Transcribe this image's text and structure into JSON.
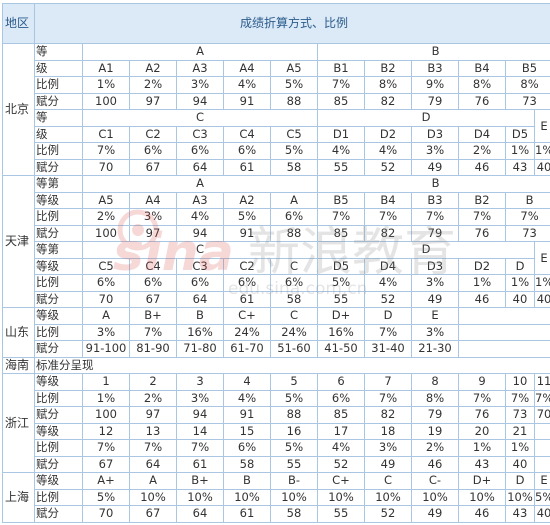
{
  "header": {
    "region": "地区",
    "title": "成绩折算方式、比例"
  },
  "watermark": {
    "brand_latin": "sina",
    "brand_cn": "新浪教育",
    "url": "edu.sina.com.cn"
  },
  "regions": {
    "beijing": {
      "name": "北京",
      "block1": {
        "label_top": "等",
        "label_grade": "级",
        "label_ratio": "比例",
        "label_score": "赋分",
        "groups": [
          "A",
          "B"
        ],
        "grades": [
          "A1",
          "A2",
          "A3",
          "A4",
          "A5",
          "B1",
          "B2",
          "B3",
          "B4",
          "B5"
        ],
        "ratios": [
          "1%",
          "2%",
          "3%",
          "4%",
          "5%",
          "7%",
          "8%",
          "9%",
          "8%",
          "8%"
        ],
        "scores": [
          "100",
          "97",
          "94",
          "91",
          "88",
          "85",
          "82",
          "79",
          "76",
          "73"
        ]
      },
      "block2": {
        "label_top": "等",
        "label_grade": "级",
        "label_ratio": "比例",
        "label_score": "赋分",
        "groups": [
          "C",
          "D",
          "E"
        ],
        "grades": [
          "C1",
          "C2",
          "C3",
          "C4",
          "C5",
          "D1",
          "D2",
          "D3",
          "D4",
          "D5"
        ],
        "ratios": [
          "7%",
          "6%",
          "6%",
          "6%",
          "5%",
          "4%",
          "4%",
          "3%",
          "2%",
          "1%",
          "1%"
        ],
        "scores": [
          "70",
          "67",
          "64",
          "61",
          "58",
          "55",
          "52",
          "49",
          "46",
          "43",
          "40"
        ]
      }
    },
    "tianjin": {
      "name": "天津",
      "block1": {
        "label_top": "等第",
        "label_grade": "等级",
        "label_ratio": "比例",
        "label_score": "赋分",
        "groups": [
          "A",
          "B"
        ],
        "grades": [
          "A5",
          "A4",
          "A3",
          "A2",
          "A",
          "B5",
          "B4",
          "B3",
          "B2",
          "B"
        ],
        "ratios": [
          "2%",
          "3%",
          "4%",
          "5%",
          "6%",
          "7%",
          "7%",
          "7%",
          "7%",
          "7%"
        ],
        "scores": [
          "100",
          "97",
          "94",
          "91",
          "88",
          "85",
          "82",
          "79",
          "76",
          "73"
        ]
      },
      "block2": {
        "label_top": "等第",
        "label_grade": "等级",
        "label_ratio": "比例",
        "label_score": "赋分",
        "groups": [
          "C",
          "D",
          "E"
        ],
        "grades": [
          "C5",
          "C4",
          "C3",
          "C2",
          "C",
          "D5",
          "D4",
          "D3",
          "D2",
          "D"
        ],
        "ratios": [
          "6%",
          "6%",
          "6%",
          "6%",
          "6%",
          "5%",
          "4%",
          "3%",
          "1%",
          "1%",
          "1%"
        ],
        "scores": [
          "70",
          "67",
          "64",
          "61",
          "58",
          "55",
          "52",
          "49",
          "46",
          "40",
          "40"
        ]
      }
    },
    "shandong": {
      "name": "山东",
      "label_grade": "等级",
      "label_ratio": "比例",
      "label_score": "赋分",
      "grades": [
        "A",
        "B+",
        "B",
        "C+",
        "C",
        "D+",
        "D",
        "E"
      ],
      "ratios": [
        "3%",
        "7%",
        "16%",
        "24%",
        "24%",
        "16%",
        "7%",
        "3%"
      ],
      "scores": [
        "91-100",
        "81-90",
        "71-80",
        "61-70",
        "51-60",
        "41-50",
        "31-40",
        "21-30"
      ]
    },
    "hainan": {
      "name": "海南",
      "note": "标准分呈现"
    },
    "zhejiang": {
      "name": "浙江",
      "block1": {
        "label_grade": "等级",
        "label_ratio": "比例",
        "label_score": "赋分",
        "grades": [
          "1",
          "2",
          "3",
          "4",
          "5",
          "6",
          "7",
          "8",
          "9",
          "10",
          "11"
        ],
        "ratios": [
          "1%",
          "2%",
          "3%",
          "4%",
          "5%",
          "6%",
          "7%",
          "8%",
          "7%",
          "7%",
          "7%"
        ],
        "scores": [
          "100",
          "97",
          "94",
          "91",
          "88",
          "85",
          "82",
          "79",
          "76",
          "73",
          "70"
        ]
      },
      "block2": {
        "label_grade": "等级",
        "label_ratio": "比例",
        "label_score": "赋分",
        "grades": [
          "12",
          "13",
          "14",
          "15",
          "16",
          "17",
          "18",
          "19",
          "20",
          "21"
        ],
        "ratios": [
          "7%",
          "7%",
          "7%",
          "6%",
          "5%",
          "4%",
          "3%",
          "2%",
          "1%",
          "1%"
        ],
        "scores": [
          "67",
          "64",
          "61",
          "58",
          "55",
          "52",
          "49",
          "46",
          "43",
          "40"
        ]
      }
    },
    "shanghai": {
      "name": "上海",
      "label_grade": "等级",
      "label_ratio": "比例",
      "label_score": "赋分",
      "grades": [
        "A+",
        "A",
        "B+",
        "B",
        "B-",
        "C+",
        "C",
        "C-",
        "D+",
        "D",
        "E"
      ],
      "ratios": [
        "5%",
        "10%",
        "10%",
        "10%",
        "10%",
        "10%",
        "10%",
        "10%",
        "10%",
        "10%",
        "5%"
      ],
      "scores": [
        "70",
        "67",
        "64",
        "61",
        "58",
        "55",
        "52",
        "49",
        "46",
        "43",
        "40"
      ]
    }
  }
}
